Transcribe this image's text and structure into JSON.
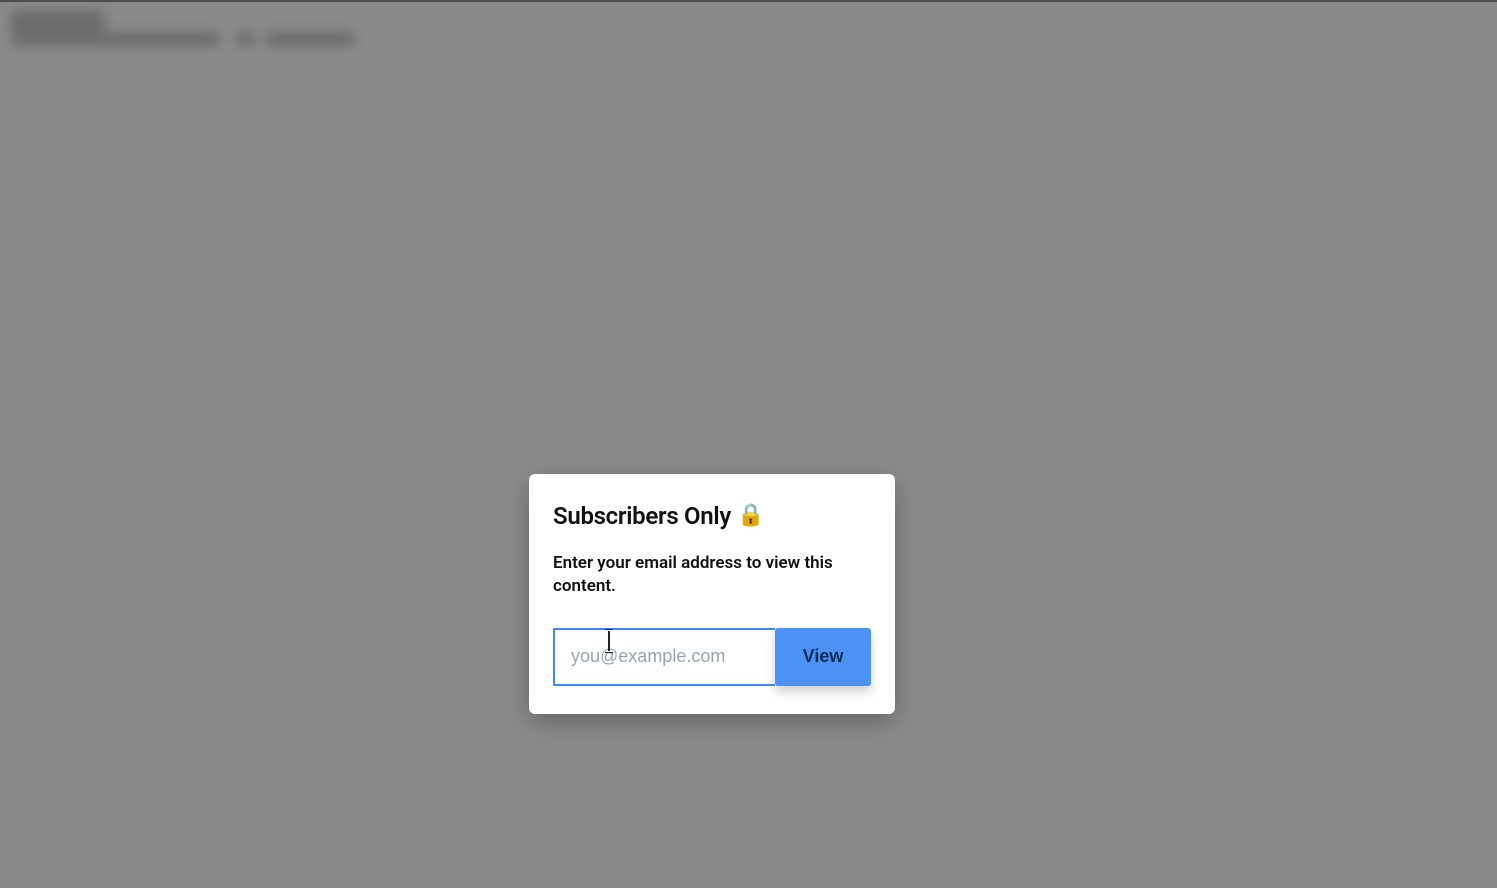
{
  "modal": {
    "title": "Subscribers Only",
    "lock_icon": "🔒",
    "description": "Enter your email address to view this content.",
    "email_placeholder": "you@example.com",
    "email_value": "",
    "submit_label": "View"
  }
}
